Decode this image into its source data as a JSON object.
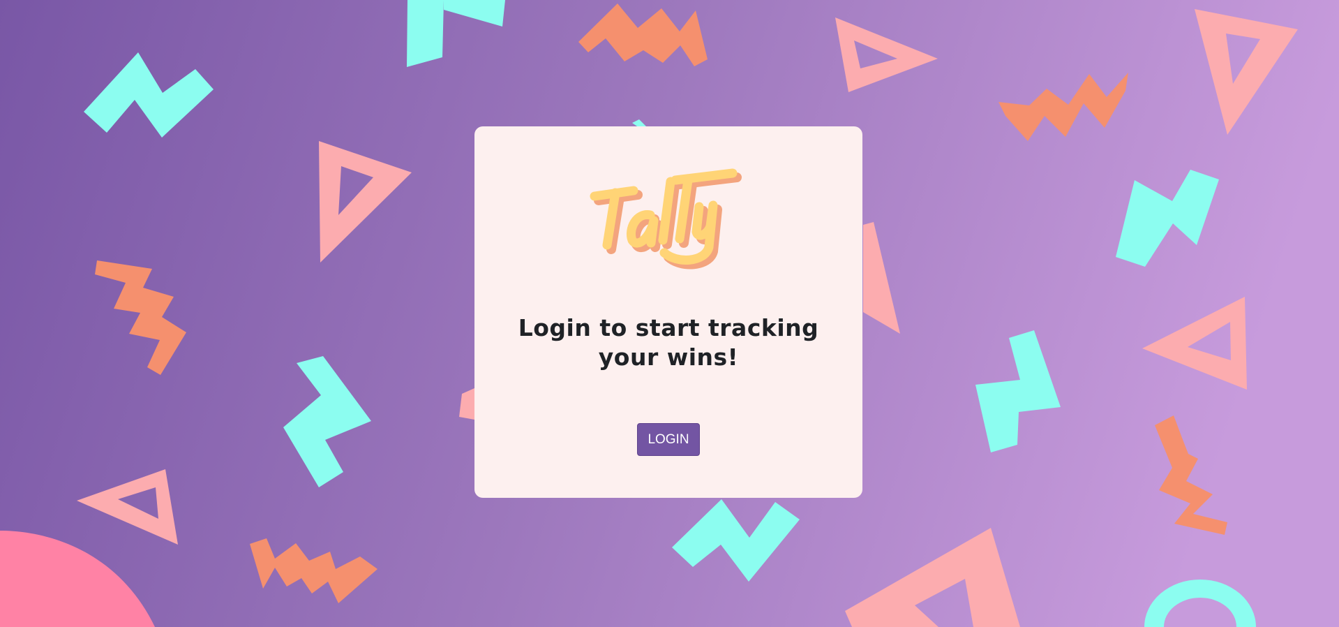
{
  "colors": {
    "bg_start": "#7957a6",
    "bg_end": "#c79bdc",
    "card_bg": "#fdf0ef",
    "cyan": "#8cfdf0",
    "orange": "#f5906e",
    "pink": "#fcacaf",
    "hot_pink": "#ff82a5",
    "logo_fill": "#ffd476",
    "logo_shadow": "#f3a47e",
    "button_bg": "#7355a3",
    "headline_text": "#1f2226"
  },
  "logo": {
    "text": "Tally",
    "icon": "tally-logo"
  },
  "headline": {
    "line1": "Login to start tracking",
    "line2": "your wins!"
  },
  "login_button": {
    "label": "LOGIN"
  }
}
